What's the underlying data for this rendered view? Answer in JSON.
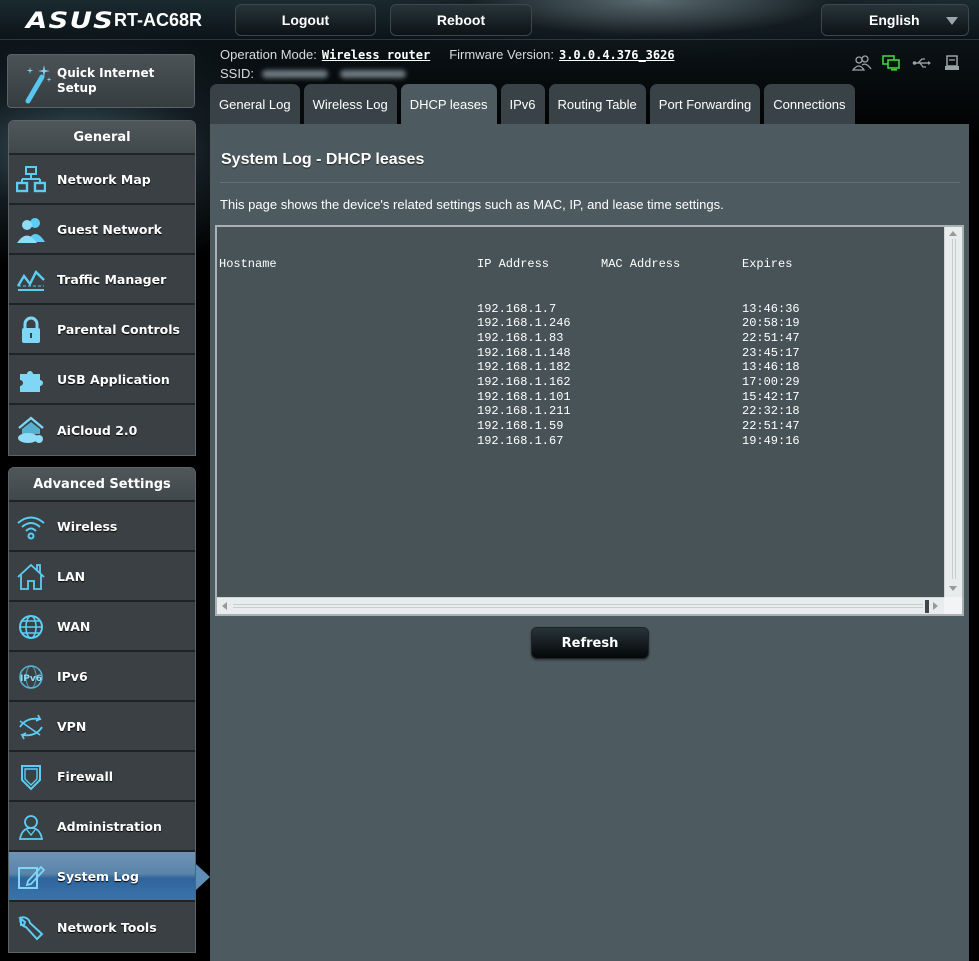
{
  "header": {
    "brand": "ASUS",
    "model": "RT-AC68R",
    "logout_label": "Logout",
    "reboot_label": "Reboot",
    "language": "English"
  },
  "info": {
    "operation_mode_label": "Operation Mode:",
    "operation_mode_value": "Wireless router",
    "firmware_label": "Firmware Version:",
    "firmware_value": "3.0.0.4.376_3626",
    "ssid_label": "SSID:"
  },
  "status_icons": [
    "clients-icon",
    "network-status-icon",
    "usb-icon",
    "printer-icon"
  ],
  "status_colors": {
    "network_connected": "#3fd33f",
    "inactive": "#9aa3a6"
  },
  "quick_setup_label": [
    "Quick Internet",
    "Setup"
  ],
  "sidebar": {
    "general_title": "General",
    "general_items": [
      {
        "label": "Network Map",
        "icon": "network-map-icon"
      },
      {
        "label": "Guest Network",
        "icon": "guest-network-icon"
      },
      {
        "label": "Traffic Manager",
        "icon": "traffic-manager-icon"
      },
      {
        "label": "Parental Controls",
        "icon": "lock-icon"
      },
      {
        "label": "USB Application",
        "icon": "puzzle-icon"
      },
      {
        "label": "AiCloud 2.0",
        "icon": "cloud-home-icon"
      }
    ],
    "advanced_title": "Advanced Settings",
    "advanced_items": [
      {
        "label": "Wireless",
        "icon": "wifi-icon"
      },
      {
        "label": "LAN",
        "icon": "home-icon"
      },
      {
        "label": "WAN",
        "icon": "globe-icon"
      },
      {
        "label": "IPv6",
        "icon": "ipv6-globe-icon"
      },
      {
        "label": "VPN",
        "icon": "vpn-icon"
      },
      {
        "label": "Firewall",
        "icon": "shield-icon"
      },
      {
        "label": "Administration",
        "icon": "admin-user-icon"
      },
      {
        "label": "System Log",
        "icon": "edit-log-icon",
        "active": true
      },
      {
        "label": "Network Tools",
        "icon": "wrench-icon"
      }
    ]
  },
  "tabs": [
    {
      "label": "General Log"
    },
    {
      "label": "Wireless Log"
    },
    {
      "label": "DHCP leases",
      "active": true
    },
    {
      "label": "IPv6"
    },
    {
      "label": "Routing Table"
    },
    {
      "label": "Port Forwarding"
    },
    {
      "label": "Connections"
    }
  ],
  "main": {
    "title": "System Log - DHCP leases",
    "description": "This page shows the device's related settings such as MAC, IP, and lease time settings.",
    "columns": [
      "Hostname",
      "IP Address",
      "MAC Address",
      "Expires"
    ],
    "rows": [
      {
        "hostname": "",
        "ip": "192.168.1.7",
        "mac": "",
        "expires": "13:46:36"
      },
      {
        "hostname": "",
        "ip": "192.168.1.246",
        "mac": "",
        "expires": "20:58:19"
      },
      {
        "hostname": "",
        "ip": "192.168.1.83",
        "mac": "",
        "expires": "22:51:47"
      },
      {
        "hostname": "",
        "ip": "192.168.1.148",
        "mac": "",
        "expires": "23:45:17"
      },
      {
        "hostname": "",
        "ip": "192.168.1.182",
        "mac": "",
        "expires": "13:46:18"
      },
      {
        "hostname": "",
        "ip": "192.168.1.162",
        "mac": "",
        "expires": "17:00:29"
      },
      {
        "hostname": "",
        "ip": "192.168.1.101",
        "mac": "",
        "expires": "15:42:17"
      },
      {
        "hostname": "",
        "ip": "192.168.1.211",
        "mac": "",
        "expires": "22:32:18"
      },
      {
        "hostname": "",
        "ip": "192.168.1.59",
        "mac": "",
        "expires": "22:51:47"
      },
      {
        "hostname": "",
        "ip": "192.168.1.67",
        "mac": "",
        "expires": "19:49:16"
      }
    ],
    "refresh_label": "Refresh"
  }
}
